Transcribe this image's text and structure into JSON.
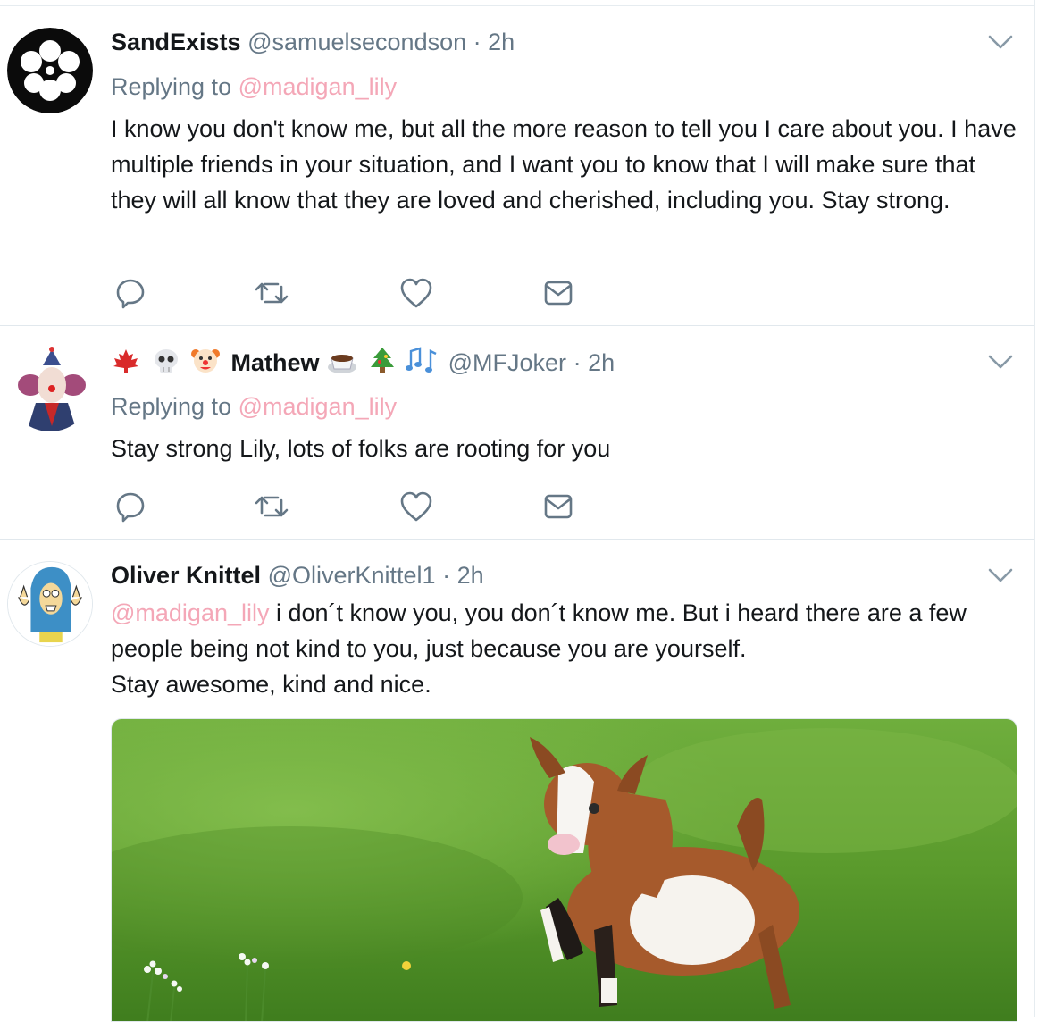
{
  "tweets": [
    {
      "display_name": "SandExists",
      "handle": "@samuelsecondson",
      "separator": "·",
      "time": "2h",
      "replying_prefix": "Replying to",
      "replying_to": "@madigan_lily",
      "text": "I know you don't know me, but all the more reason to tell you I care about you. I have multiple friends in your situation, and I want you to know that I will make sure that they will all know that they are loved and cherished, including you. Stay strong."
    },
    {
      "display_name": "Mathew",
      "handle": "@MFJoker",
      "separator": "·",
      "time": "2h",
      "replying_prefix": "Replying to",
      "replying_to": "@madigan_lily",
      "text": "Stay strong Lily, lots of folks are rooting for you"
    },
    {
      "display_name": "Oliver Knittel",
      "handle": "@OliverKnittel1",
      "separator": "·",
      "time": "2h",
      "mention": "@madigan_lily",
      "text_line1": " i don´t know you, you don´t know me. But i heard there are a few people being not kind to you, just because you are yourself.",
      "text_line2": "Stay awesome, kind and nice."
    }
  ],
  "icons": [
    "reply-icon",
    "retweet-icon",
    "like-icon",
    "message-icon",
    "chevron-down-icon"
  ],
  "colors": {
    "mention": "#f4a7b7",
    "secondary": "#657786",
    "divider": "#e1e8ed"
  }
}
